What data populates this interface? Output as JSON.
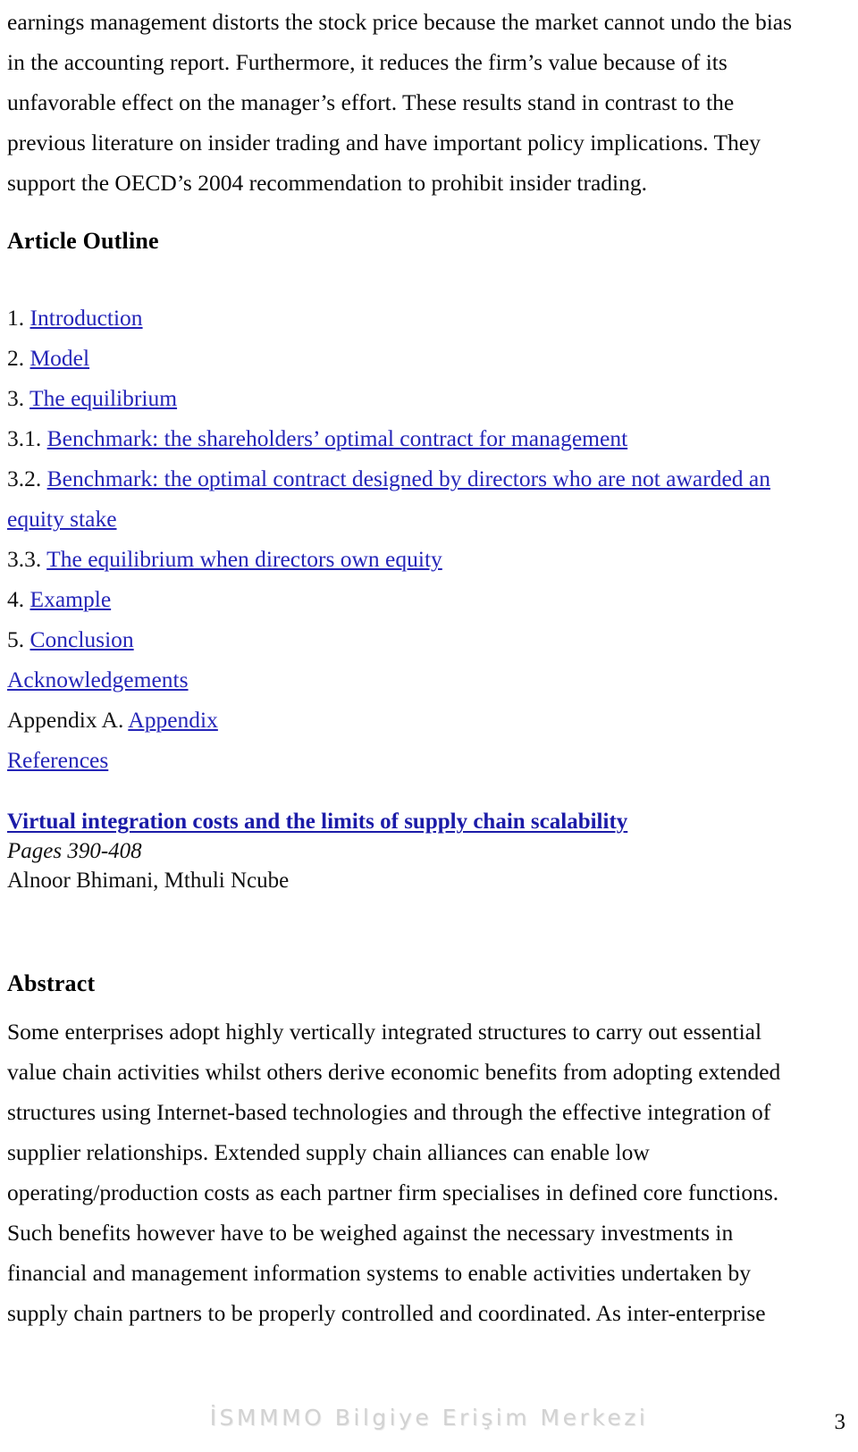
{
  "document": {
    "page_number": "3",
    "watermark": "İSMMMO Bilgiye Erişim Merkezi"
  },
  "continued_paragraph": {
    "text": "earnings management distorts the stock price because the market cannot undo the bias in the accounting report. Furthermore, it reduces the firm’s value because of its unfavorable effect on the manager’s effort. These results stand in contrast to the previous literature on insider trading and have important policy implications. They support the OECD’s 2004 recommendation to prohibit insider trading."
  },
  "outline_section": {
    "heading": "Article Outline",
    "items": [
      {
        "number": "1.",
        "link": "Introduction",
        "plain": ""
      },
      {
        "number": "2.",
        "link": "Model",
        "plain": ""
      },
      {
        "number": "3.",
        "link": "The equilibrium",
        "plain": ""
      },
      {
        "number": "3.1.",
        "link": "Benchmark: the shareholders’ optimal contract for management",
        "plain": ""
      },
      {
        "number": "3.2.",
        "link": "Benchmark: the optimal contract designed by directors who are not awarded an equity stake",
        "plain": ""
      },
      {
        "number": "3.3.",
        "link": "The equilibrium when directors own equity",
        "plain": ""
      },
      {
        "number": "4.",
        "link": "Example",
        "plain": ""
      },
      {
        "number": "5.",
        "link": "Conclusion",
        "plain": ""
      },
      {
        "number": "",
        "link": "Acknowledgements",
        "plain": ""
      },
      {
        "number": "",
        "link": "Appendix",
        "plain": "Appendix A."
      },
      {
        "number": "",
        "link": "References",
        "plain": ""
      }
    ]
  },
  "article_entry": {
    "title": "Virtual integration costs and the limits of supply chain scalability",
    "pages": "Pages 390-408",
    "authors": "Alnoor Bhimani, Mthuli Ncube"
  },
  "abstract_section": {
    "heading": "Abstract",
    "text": "Some enterprises adopt highly vertically integrated structures to carry out essential value chain activities whilst others derive economic benefits from adopting extended structures using Internet-based technologies and through the effective integration of supplier relationships. Extended supply chain alliances can enable low operating/production costs as each partner firm specialises in defined core functions. Such benefits however have to be weighed against the necessary investments in financial and management information systems to enable activities undertaken by supply chain partners to be properly controlled and coordinated. As inter-enterprise"
  }
}
